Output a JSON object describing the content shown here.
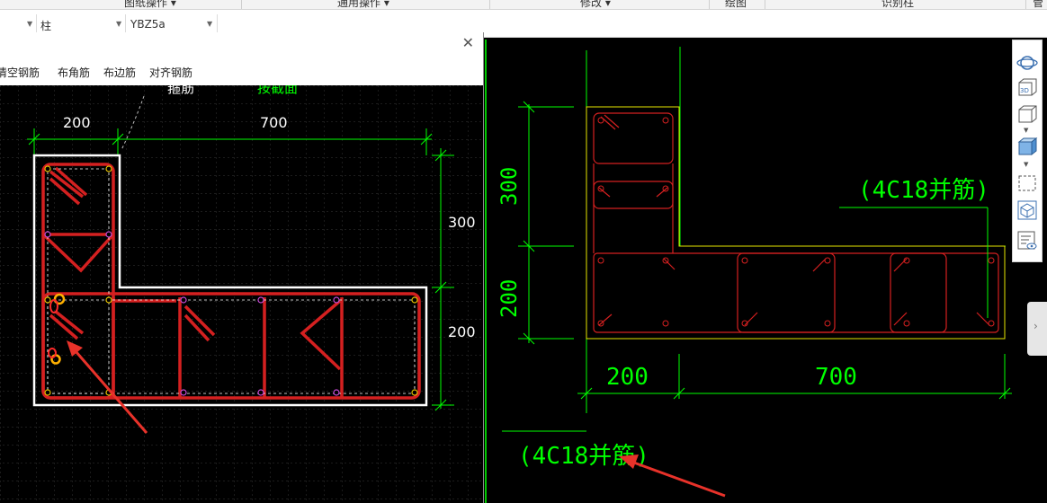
{
  "ribbon": {
    "tabs": [
      "图纸操作 ▾",
      "通用操作 ▾",
      "修改 ▾",
      "绘图",
      "识别柱",
      "管"
    ]
  },
  "propbar": {
    "category": "柱",
    "component": "YBZ5a"
  },
  "dialog": {
    "toolbar": [
      "清空钢筋",
      "布角筋",
      "布边筋",
      "对齐钢筋"
    ]
  },
  "left_drawing": {
    "labels": {
      "stirrup": "箍筋",
      "edit_section": "按截面",
      "dim_200_top": "200",
      "dim_700_top": "700",
      "dim_300_right": "300",
      "dim_200_right": "200"
    }
  },
  "right_drawing": {
    "labels": {
      "dim_300": "300",
      "dim_200": "200",
      "dim_200_bottom": "200",
      "dim_700_bottom": "700",
      "rebar_note_1": "(4C18并筋)",
      "rebar_note_2": "(4C18并筋)"
    }
  },
  "colors": {
    "cad_green": "#00ff00",
    "rebar_red": "#d42020",
    "outline_yellow": "#e6e600",
    "annotation_arrow": "#e8322a"
  },
  "right_toolbar": {
    "icons": [
      "orbit-icon",
      "view-3d-icon",
      "box-view-icon",
      "box-solid-icon",
      "select-region-icon",
      "cube-check-icon",
      "properties-eye-icon"
    ]
  }
}
